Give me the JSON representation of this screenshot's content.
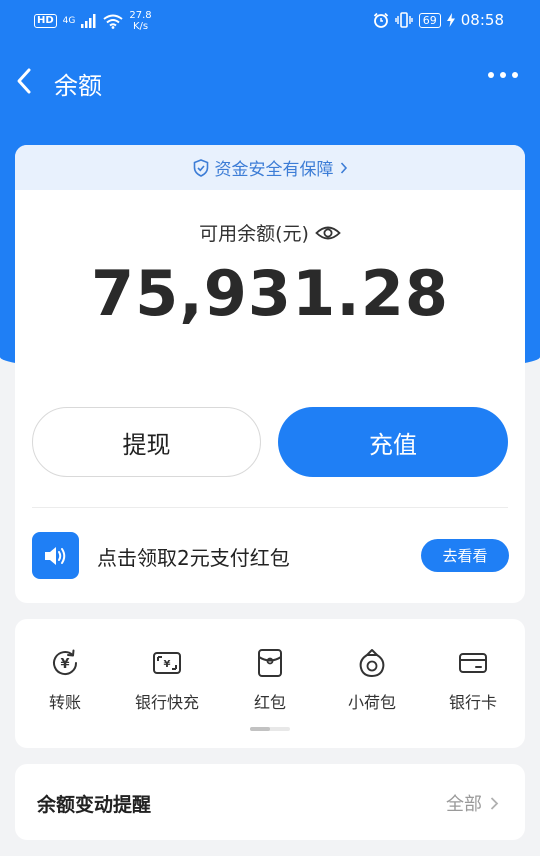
{
  "status_bar": {
    "hd": "HD",
    "network": "4G",
    "speed_value": "27.8",
    "speed_unit": "K/s",
    "battery": "69",
    "time": "08:58"
  },
  "nav": {
    "title": "余额"
  },
  "security": {
    "label": "资金安全有保障"
  },
  "balance": {
    "label": "可用余额(元)",
    "value": "75,931.28"
  },
  "actions": {
    "withdraw": "提现",
    "recharge": "充值"
  },
  "promo": {
    "text": "点击领取2元支付红包",
    "button": "去看看"
  },
  "shortcuts": [
    {
      "label": "转账",
      "icon": "transfer-icon"
    },
    {
      "label": "银行快充",
      "icon": "bank-quick-recharge-icon"
    },
    {
      "label": "红包",
      "icon": "red-packet-icon"
    },
    {
      "label": "小荷包",
      "icon": "small-pouch-icon"
    },
    {
      "label": "银行卡",
      "icon": "bank-card-icon"
    }
  ],
  "alert": {
    "title": "余额变动提醒",
    "all": "全部"
  },
  "colors": {
    "brand_blue": "#1f7ff5",
    "background": "#f2f3f5"
  }
}
